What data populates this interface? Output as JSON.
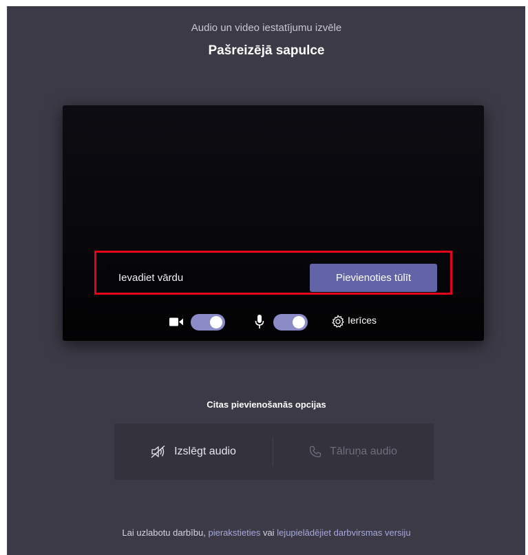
{
  "header": {
    "subtitle": "Audio un video iestatījumu izvēle",
    "title": "Pašreizējā sapulce"
  },
  "join": {
    "name_placeholder": "Ievadiet vārdu",
    "join_button": "Pievienoties tūlīt"
  },
  "controls": {
    "camera_icon": "camera-icon",
    "camera_toggle_on": true,
    "mic_icon": "microphone-icon",
    "mic_toggle_on": true,
    "devices_icon": "gear-icon",
    "devices_label": "Ierīces"
  },
  "other_options": {
    "title": "Citas pievienošanās opcijas",
    "audio_off_label": "Izslēgt audio",
    "audio_off_icon": "speaker-muted-icon",
    "phone_audio_label": "Tālruņa audio",
    "phone_audio_icon": "phone-icon"
  },
  "footer": {
    "text_before": "Lai uzlabotu darbību, ",
    "sign_in_link": "pierakstieties",
    "text_middle": " vai ",
    "download_link": "lejupielādējiet darbvirsmas versiju"
  },
  "colors": {
    "page_bg": "#3b3a46",
    "accent": "#6264a7",
    "toggle_on": "#8b8cc7",
    "highlight": "#e5001e"
  }
}
